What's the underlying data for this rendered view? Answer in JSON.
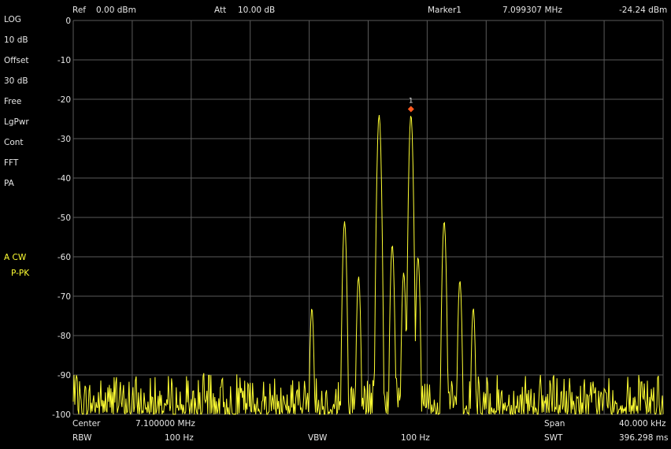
{
  "header": {
    "ref_label": "Ref",
    "ref_value": "0.00 dBm",
    "att_label": "Att",
    "att_value": "10.00 dB",
    "marker_label": "Marker1",
    "marker_freq": "7.099307 MHz",
    "marker_level": "-24.24 dBm"
  },
  "sidebar": {
    "items": [
      "LOG",
      "10 dB",
      "Offset",
      "30 dB",
      "Free",
      "LgPwr",
      "Cont",
      "FFT",
      "PA"
    ],
    "trace_items": [
      "A CW",
      "P-PK"
    ],
    "trace_color": "#ffff33"
  },
  "footer": {
    "center_label": "Center",
    "center_value": "7.100000 MHz",
    "span_label": "Span",
    "span_value": "40.000 kHz",
    "rbw_label": "RBW",
    "rbw_value": "100 Hz",
    "vbw_label": "VBW",
    "vbw_value": "100 Hz",
    "swt_label": "SWT",
    "swt_value": "396.298 ms"
  },
  "colors": {
    "background": "#000000",
    "grid": "#5a5a5a",
    "trace": "#ffff33",
    "marker": "#ff5a1f",
    "text": "#e6e6e6"
  },
  "chart_data": {
    "type": "line",
    "xlim": [
      7.08,
      7.12
    ],
    "ylim": [
      -100,
      0
    ],
    "yticks": [
      0,
      -10,
      -20,
      -30,
      -40,
      -50,
      -60,
      -70,
      -80,
      -90,
      -100
    ],
    "grid": true,
    "x_divisions": 10,
    "y_divisions": 10,
    "noise_floor": [
      -100,
      -91
    ],
    "peaks": [
      {
        "x": 7.09618,
        "y": -73
      },
      {
        "x": 7.0984,
        "y": -51
      },
      {
        "x": 7.09935,
        "y": -65
      },
      {
        "x": 7.10074,
        "y": -24
      },
      {
        "x": 7.10163,
        "y": -57
      },
      {
        "x": 7.10241,
        "y": -64
      },
      {
        "x": 7.1029,
        "y": -24
      },
      {
        "x": 7.10338,
        "y": -60
      },
      {
        "x": 7.10515,
        "y": -51
      },
      {
        "x": 7.10622,
        "y": -66
      },
      {
        "x": 7.10713,
        "y": -73
      }
    ],
    "marker": {
      "x": 7.1029,
      "y": -22.5,
      "label": "1"
    }
  }
}
